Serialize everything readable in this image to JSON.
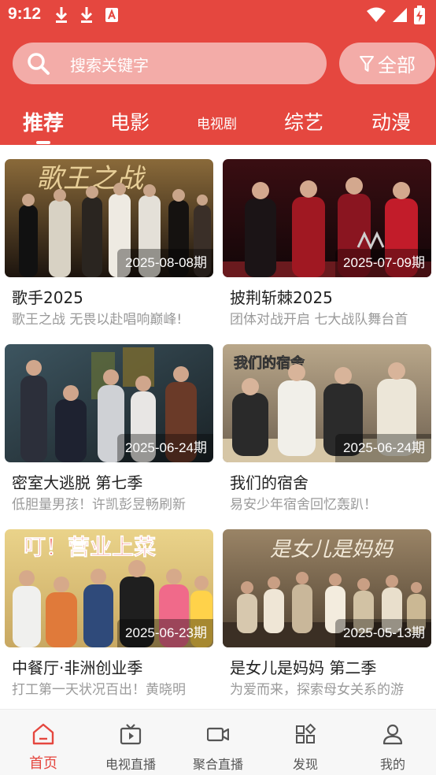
{
  "status_bar": {
    "time": "9:12",
    "left_icons": [
      "download-icon",
      "download-icon",
      "app-notification-icon"
    ],
    "right_icons": [
      "wifi-icon",
      "signal-icon",
      "battery-charging-icon"
    ]
  },
  "search": {
    "placeholder": "搜索关键字"
  },
  "filter_button": {
    "label": "全部",
    "icon": "filter-icon"
  },
  "tabs": [
    {
      "label": "推荐",
      "active": true
    },
    {
      "label": "电影",
      "active": false
    },
    {
      "label": "电视剧",
      "active": false
    },
    {
      "label": "综艺",
      "active": false
    },
    {
      "label": "动漫",
      "active": false
    }
  ],
  "cards": [
    {
      "title": "歌手2025",
      "desc": "歌王之战 无畏以赴唱响巅峰!",
      "episode": "2025-08-08期",
      "image_text": "歌王之战"
    },
    {
      "title": "披荆斩棘2025",
      "desc": "团体对战开启 七大战队舞台首",
      "episode": "2025-07-09期",
      "image_text": ""
    },
    {
      "title": "密室大逃脱 第七季",
      "desc": "低胆量男孩！许凯彭昱畅刷新",
      "episode": "2025-06-24期",
      "image_text": ""
    },
    {
      "title": "我们的宿舍",
      "desc": "易安少年宿舍回忆轰趴！",
      "episode": "2025-06-24期",
      "image_text": "我们的宿舍"
    },
    {
      "title": "中餐厅·非洲创业季",
      "desc": "打工第一天状况百出！黄晓明",
      "episode": "2025-06-23期",
      "image_text": "叮！营业上菜"
    },
    {
      "title": "是女儿是妈妈 第二季",
      "desc": "为爱而来，探索母女关系的游",
      "episode": "2025-05-13期",
      "image_text": "是女儿是妈妈"
    }
  ],
  "bottom_nav": [
    {
      "label": "首页",
      "icon": "home-icon",
      "active": true
    },
    {
      "label": "电视直播",
      "icon": "tv-icon",
      "active": false
    },
    {
      "label": "聚合直播",
      "icon": "video-camera-icon",
      "active": false
    },
    {
      "label": "发现",
      "icon": "discover-grid-icon",
      "active": false
    },
    {
      "label": "我的",
      "icon": "user-icon",
      "active": false
    }
  ],
  "colors": {
    "primary": "#e5473f",
    "text": "#222222",
    "muted": "#9a9a9a",
    "nav_bg": "#f7f7f7"
  }
}
